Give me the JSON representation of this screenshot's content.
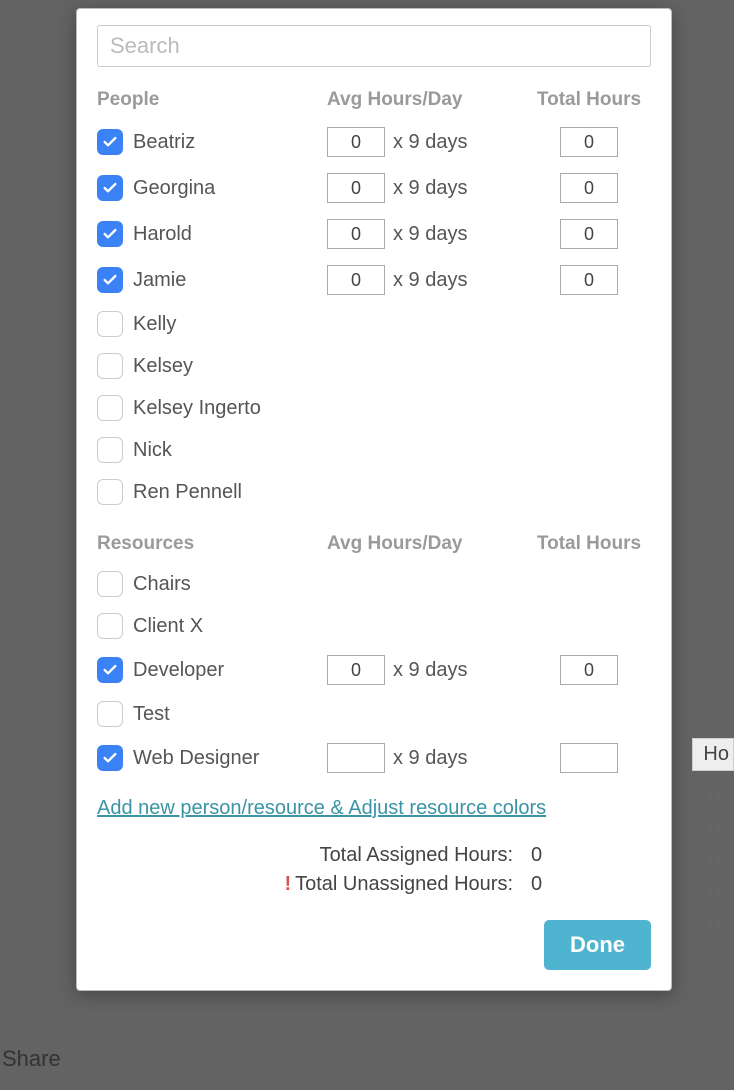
{
  "search": {
    "placeholder": "Search"
  },
  "headers": {
    "people": "People",
    "resources": "Resources",
    "avg": "Avg Hours/Day",
    "total": "Total Hours"
  },
  "days_suffix": "x 9 days",
  "people": [
    {
      "name": "Beatriz",
      "checked": true,
      "avg": "0",
      "total": "0"
    },
    {
      "name": "Georgina",
      "checked": true,
      "avg": "0",
      "total": "0"
    },
    {
      "name": "Harold",
      "checked": true,
      "avg": "0",
      "total": "0"
    },
    {
      "name": "Jamie",
      "checked": true,
      "avg": "0",
      "total": "0"
    },
    {
      "name": "Kelly",
      "checked": false
    },
    {
      "name": "Kelsey",
      "checked": false
    },
    {
      "name": "Kelsey Ingerto",
      "checked": false
    },
    {
      "name": "Nick",
      "checked": false
    },
    {
      "name": "Ren Pennell",
      "checked": false
    }
  ],
  "resources": [
    {
      "name": "Chairs",
      "checked": false
    },
    {
      "name": "Client X",
      "checked": false
    },
    {
      "name": "Developer",
      "checked": true,
      "avg": "0",
      "total": "0"
    },
    {
      "name": "Test",
      "checked": false
    },
    {
      "name": "Web Designer",
      "checked": true,
      "avg": "",
      "total": ""
    }
  ],
  "add_link": "Add new person/resource & Adjust resource colors",
  "totals": {
    "assigned_label": "Total Assigned Hours:",
    "assigned_value": "0",
    "unassigned_label": "Total Unassigned Hours:",
    "unassigned_value": "0"
  },
  "done": "Done",
  "background": {
    "share": "Share",
    "hou": "Ho",
    "zeros": [
      "0",
      "0",
      "0",
      "0",
      "0"
    ]
  }
}
